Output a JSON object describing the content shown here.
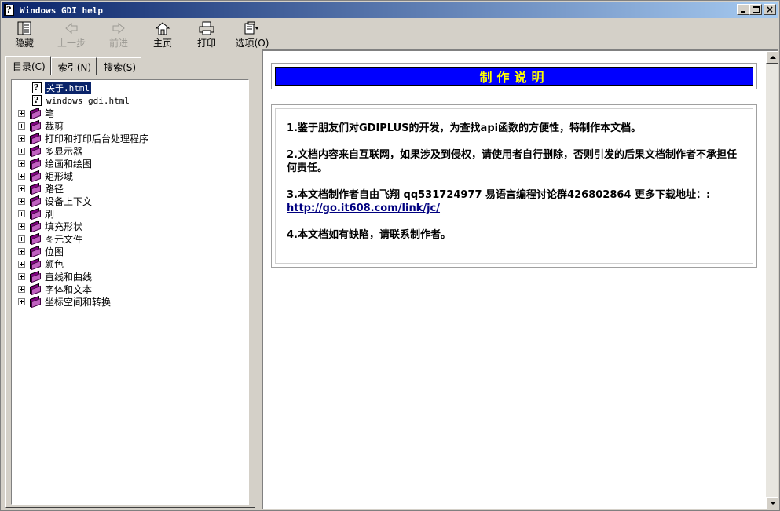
{
  "window": {
    "title": "Windows GDI help"
  },
  "toolbar": {
    "items": [
      {
        "label": "隐藏",
        "icon": "hide-pane-icon",
        "enabled": true
      },
      {
        "label": "上一步",
        "icon": "back-arrow-icon",
        "enabled": false
      },
      {
        "label": "前进",
        "icon": "forward-arrow-icon",
        "enabled": false
      },
      {
        "label": "主页",
        "icon": "home-icon",
        "enabled": true
      },
      {
        "label": "打印",
        "icon": "printer-icon",
        "enabled": true
      },
      {
        "label": "选项(O)",
        "icon": "options-icon",
        "enabled": true
      }
    ]
  },
  "nav_tabs": [
    {
      "label": "目录(C)",
      "active": true
    },
    {
      "label": "索引(N)",
      "active": false
    },
    {
      "label": "搜索(S)",
      "active": false
    }
  ],
  "tree": {
    "topics": [
      {
        "label": "关于.html",
        "selected": true
      },
      {
        "label": "windows gdi.html",
        "selected": false
      }
    ],
    "books": [
      "笔",
      "裁剪",
      "打印和打印后台处理程序",
      "多显示器",
      "绘画和绘图",
      "矩形域",
      "路径",
      "设备上下文",
      "刷",
      "填充形状",
      "图元文件",
      "位图",
      "颜色",
      "直线和曲线",
      "字体和文本",
      "坐标空间和转换"
    ]
  },
  "content": {
    "heading": "制作说明",
    "paragraphs": [
      "1.鉴于朋友们对GDIPLUS的开发，为查找api函数的方便性，特制作本文档。",
      "2.文档内容来自互联网，如果涉及到侵权，请使用者自行删除，否则引发的后果文档制作者不承担任何责任。",
      "3.本文档制作者自由飞翔 qq531724977 易语言编程讨论群426802864 更多下载地址：:",
      "4.本文档如有缺陷，请联系制作者。"
    ],
    "link": "http://go.it608.com/link/jc/"
  },
  "colors": {
    "heading_bg": "#0000ff",
    "heading_text": "#ffff00",
    "titlebar_start": "#0a246a",
    "titlebar_end": "#a6caf0",
    "book_icon": "#800080"
  }
}
